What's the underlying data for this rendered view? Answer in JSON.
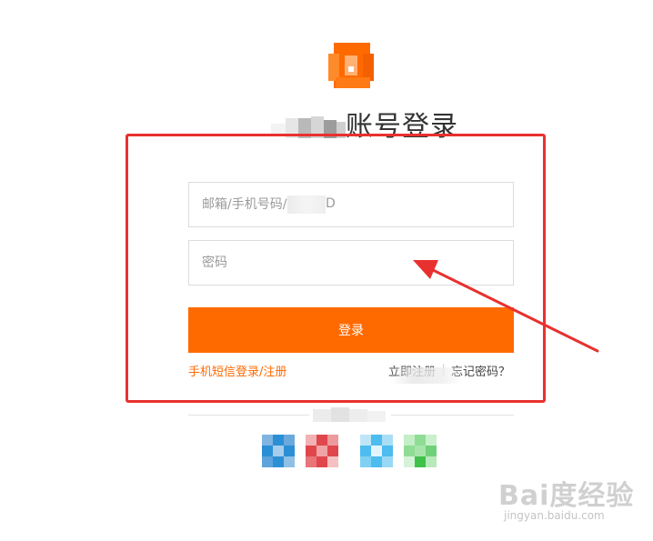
{
  "header": {
    "title": "账号登录",
    "logo_icon": "brand-logo-icon"
  },
  "form": {
    "account_placeholder": "邮箱/手机号码/",
    "account_placeholder_tail": "D",
    "password_placeholder": "密码",
    "login_label": "登录"
  },
  "links": {
    "sms_login": "手机短信登录/注册",
    "register": "立即注册",
    "separator": "|",
    "forgot_password": "忘记密码？"
  },
  "social": [
    {
      "name": "weibo-icon",
      "color": "#2b8fd6"
    },
    {
      "name": "taobao-icon",
      "color": "#e0474c"
    },
    {
      "name": "alipay-icon",
      "color": "#4dbcef"
    },
    {
      "name": "wechat-icon",
      "color": "#3fc14a"
    }
  ],
  "annotation": {
    "box_color": "#e8312e",
    "arrow_color": "#e8312e"
  },
  "watermark": {
    "logo": "Bai度经验",
    "url": "jingyan.baidu.com"
  },
  "colors": {
    "accent": "#ff6a00",
    "text": "#333333",
    "border": "#dcdcdc"
  }
}
